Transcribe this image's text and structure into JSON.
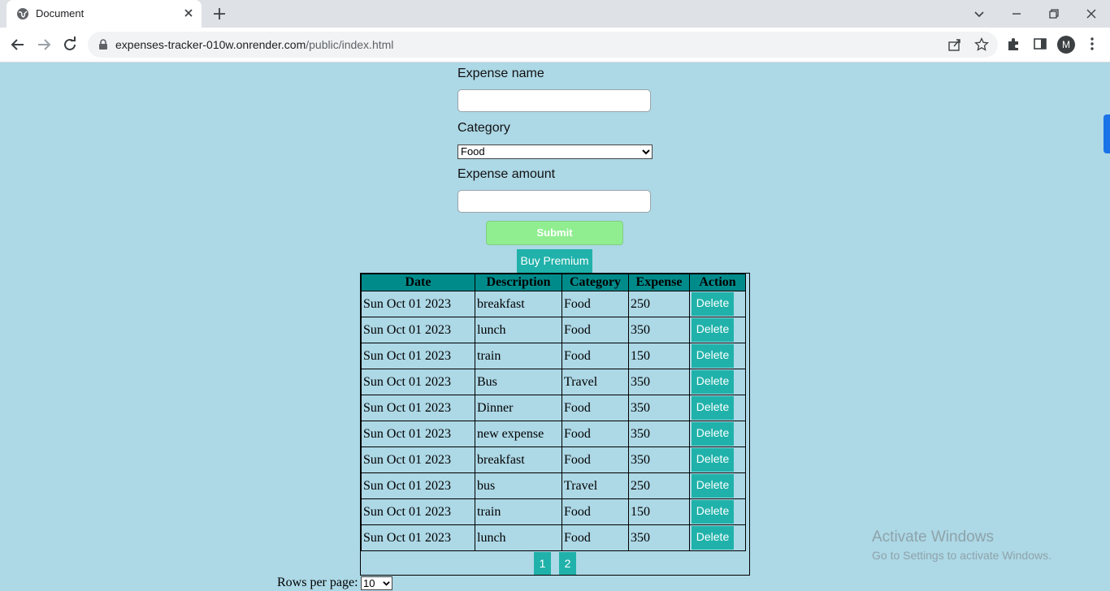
{
  "browser": {
    "tab_title": "Document",
    "url_host": "expenses-tracker-010w.onrender.com",
    "url_path": "/public/index.html",
    "profile_initial": "M"
  },
  "form": {
    "name_label": "Expense name",
    "name_value": "",
    "category_label": "Category",
    "category_selected": "Food",
    "amount_label": "Expense amount",
    "amount_value": "",
    "submit_label": "Submit",
    "premium_label": "Buy Premium"
  },
  "table": {
    "headers": [
      "Date",
      "Description",
      "Category",
      "Expense",
      "Action"
    ],
    "rows": [
      {
        "date": "Sun Oct 01 2023",
        "description": "breakfast",
        "category": "Food",
        "expense": "250",
        "action": "Delete"
      },
      {
        "date": "Sun Oct 01 2023",
        "description": "lunch",
        "category": "Food",
        "expense": "350",
        "action": "Delete"
      },
      {
        "date": "Sun Oct 01 2023",
        "description": "train",
        "category": "Food",
        "expense": "150",
        "action": "Delete"
      },
      {
        "date": "Sun Oct 01 2023",
        "description": "Bus",
        "category": "Travel",
        "expense": "350",
        "action": "Delete"
      },
      {
        "date": "Sun Oct 01 2023",
        "description": "Dinner",
        "category": "Food",
        "expense": "350",
        "action": "Delete"
      },
      {
        "date": "Sun Oct 01 2023",
        "description": "new expense",
        "category": "Food",
        "expense": "350",
        "action": "Delete"
      },
      {
        "date": "Sun Oct 01 2023",
        "description": "breakfast",
        "category": "Food",
        "expense": "350",
        "action": "Delete"
      },
      {
        "date": "Sun Oct 01 2023",
        "description": "bus",
        "category": "Travel",
        "expense": "250",
        "action": "Delete"
      },
      {
        "date": "Sun Oct 01 2023",
        "description": "train",
        "category": "Food",
        "expense": "150",
        "action": "Delete"
      },
      {
        "date": "Sun Oct 01 2023",
        "description": "lunch",
        "category": "Food",
        "expense": "350",
        "action": "Delete"
      }
    ]
  },
  "pagination": {
    "pages": [
      "1",
      "2"
    ],
    "rows_per_page_label": "Rows per page:",
    "rows_per_page_value": "10"
  },
  "watermark": {
    "title": "Activate Windows",
    "subtitle": "Go to Settings to activate Windows."
  },
  "colors": {
    "page_background": "#add8e6",
    "header_background": "#008b8b",
    "button_teal": "#20b2aa",
    "submit_green": "#90ee90"
  },
  "icons": {
    "tab_favicon": "globe-icon",
    "lock": "lock-icon",
    "share": "share-icon",
    "bookmark": "star-icon",
    "extensions": "puzzle-icon",
    "side_panel": "side-panel-icon",
    "menu": "kebab-menu-icon"
  }
}
